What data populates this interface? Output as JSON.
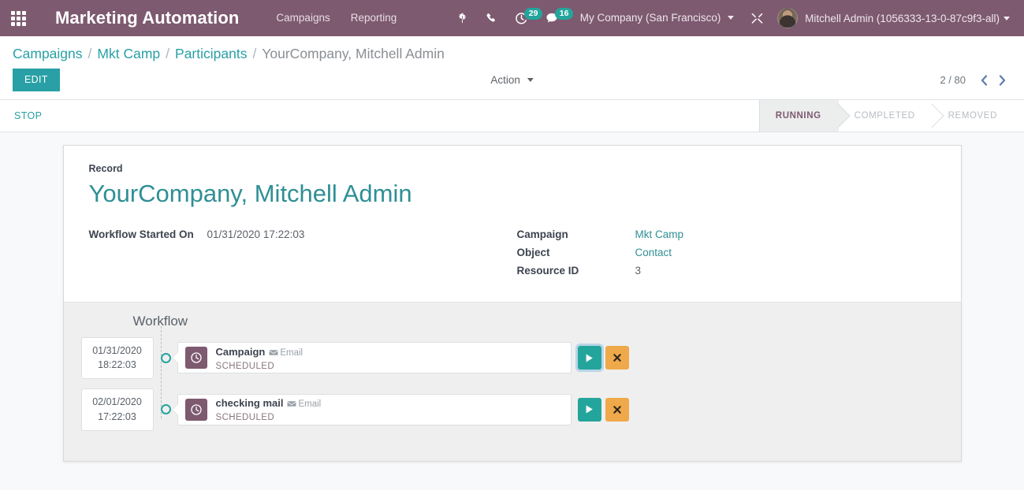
{
  "navbar": {
    "apps_icon": "apps-grid-icon",
    "brand": "Marketing Automation",
    "menus": [
      {
        "label": "Campaigns"
      },
      {
        "label": "Reporting"
      }
    ],
    "icons": [
      {
        "name": "bug-icon",
        "badge": null
      },
      {
        "name": "phone-icon",
        "badge": null
      },
      {
        "name": "activity-clock-icon",
        "badge": "29"
      },
      {
        "name": "messages-icon",
        "badge": "16"
      }
    ],
    "company": "My Company (San Francisco)",
    "tools_icon": "tools-icon",
    "user": "Mitchell Admin (1056333-13-0-87c9f3-all)",
    "avatar_name": "user-avatar"
  },
  "breadcrumb": {
    "items": [
      {
        "label": "Campaigns",
        "active": false
      },
      {
        "label": "Mkt Camp",
        "active": false
      },
      {
        "label": "Participants",
        "active": false
      },
      {
        "label": "YourCompany, Mitchell Admin",
        "active": true
      }
    ],
    "separator": "/"
  },
  "controls": {
    "edit_label": "EDIT",
    "action_label": "Action",
    "pager_value": "2 / 80",
    "prev_icon": "chevron-left-icon",
    "next_icon": "chevron-right-icon"
  },
  "statusbar": {
    "stop_label": "STOP",
    "stages": [
      {
        "label": "RUNNING",
        "active": true
      },
      {
        "label": "COMPLETED",
        "active": false
      },
      {
        "label": "REMOVED",
        "active": false
      }
    ]
  },
  "record": {
    "section_label": "Record",
    "title": "YourCompany, Mitchell Admin",
    "left_fields": [
      {
        "label": "Workflow Started On",
        "value": "01/31/2020 17:22:03",
        "link": false
      }
    ],
    "right_fields": [
      {
        "label": "Campaign",
        "value": "Mkt Camp",
        "link": true
      },
      {
        "label": "Object",
        "value": "Contact",
        "link": true
      },
      {
        "label": "Resource ID",
        "value": "3",
        "link": false
      }
    ]
  },
  "workflow": {
    "title": "Workflow",
    "rows": [
      {
        "date": "01/31/2020",
        "time": "18:22:03",
        "icon": "clock-icon",
        "name": "Campaign",
        "channel_icon": "envelope-icon",
        "channel": "Email",
        "state": "SCHEDULED",
        "run_icon": "play-icon",
        "cancel_icon": "cancel-x-icon",
        "focused": true
      },
      {
        "date": "02/01/2020",
        "time": "17:22:03",
        "icon": "clock-icon",
        "name": "checking mail",
        "channel_icon": "envelope-icon",
        "channel": "Email",
        "state": "SCHEDULED",
        "run_icon": "play-icon",
        "cancel_icon": "cancel-x-icon",
        "focused": false
      }
    ]
  },
  "colors": {
    "brand_purple": "#7d5a70",
    "teal": "#28a0a5",
    "teal_button": "#24a59c",
    "amber": "#efa94a",
    "badge_teal": "#24a59c",
    "workflow_bg": "#efefef"
  }
}
